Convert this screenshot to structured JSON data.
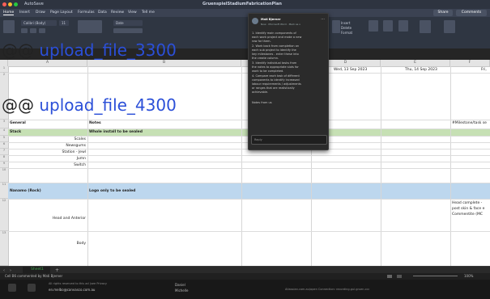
{
  "window": {
    "title": "GruenspielStadiumFabricationPlan",
    "autosave": "AutoSave",
    "share_label": "Share",
    "comments_label": "Comments"
  },
  "ribbon": {
    "tabs": [
      "Home",
      "Insert",
      "Draw",
      "Page Layout",
      "Formulas",
      "Data",
      "Review",
      "View",
      "Tell me"
    ],
    "active_tab": "Home",
    "font_name": "Calibri (Body)",
    "font_size": "11",
    "number_format": "Date",
    "groups": [
      "Conditional Formatting",
      "Format as Table",
      "Cell Styles",
      "Insert",
      "Delete",
      "Format",
      "Sort & Filter",
      "Find & Select",
      "Analyse Data",
      "Sensitivity"
    ]
  },
  "overlay_links": [
    {
      "prefix": "@@ ",
      "text": "upload_file_3300"
    },
    {
      "prefix": "@@ ",
      "text": "upload_file_4300"
    }
  ],
  "columns": [
    "A",
    "B",
    "C",
    "D",
    "E",
    "F",
    "G",
    "H"
  ],
  "row_numbers": [
    "1",
    "2",
    "3",
    "4",
    "5",
    "6",
    "7",
    "8",
    "9",
    "10",
    "11",
    "12",
    "13"
  ],
  "grid": {
    "date_headers": [
      "Wed, 13 Sep 2023",
      "Thu, 14 Sep 2023",
      "Fri,"
    ],
    "general": "General",
    "notes": "Notes",
    "right_note": "#Milestone/task se",
    "stack_label": "Stack",
    "stack_note": "Whole install to be sealed",
    "stack_items": [
      "Scales",
      "Newsgums",
      "Station - Jewl",
      "Jumn",
      "Switch"
    ],
    "section2_label": "Nanamo (Rock)",
    "section2_note": "Logo only to be sealed",
    "head_label": "Head and Anterior",
    "body_label": "Body",
    "right_notes2": [
      "Head complete -",
      "post skin & face e",
      "Commentite (MC"
    ]
  },
  "popup": {
    "title": "Mati Bjerner",
    "subtitle": "Now · Microsoft Word · Mark as v",
    "lines": [
      "1. Identify main components of",
      "each work project and make a new",
      "row for them.",
      "2. Work back from completion on",
      "each sub project to identify the",
      "key milestones - enter these into",
      "the create column.",
      "3. Identify individual tasks from",
      "the notes to appropriate slots for",
      "work to be completed.",
      "4. Compare each task of different",
      "components to identify increased",
      "labour requirements / adjustments",
      "or ranges that are realistically",
      "achievable.",
      "",
      "Notes from us"
    ],
    "reply_placeholder": "Reply"
  },
  "sheets": {
    "active": "Sheet1",
    "add_label": "+"
  },
  "status": {
    "left": "Cell B6 commented by Mati Bjerner",
    "zoom": "100%"
  },
  "dock": {
    "left1": "All rights reserved to this ad (see Privacy",
    "left2": "en.melbo@canvasco.com.au",
    "mid1": "Daniel",
    "mid2": "Michelle",
    "right": "Atlassian.com.au/open   Connection: recording.gul.gruen.ccc"
  },
  "colors": {
    "green_band": "#c6e0b4",
    "blue_band": "#bdd7ee",
    "accent": "#2b4fd8"
  }
}
